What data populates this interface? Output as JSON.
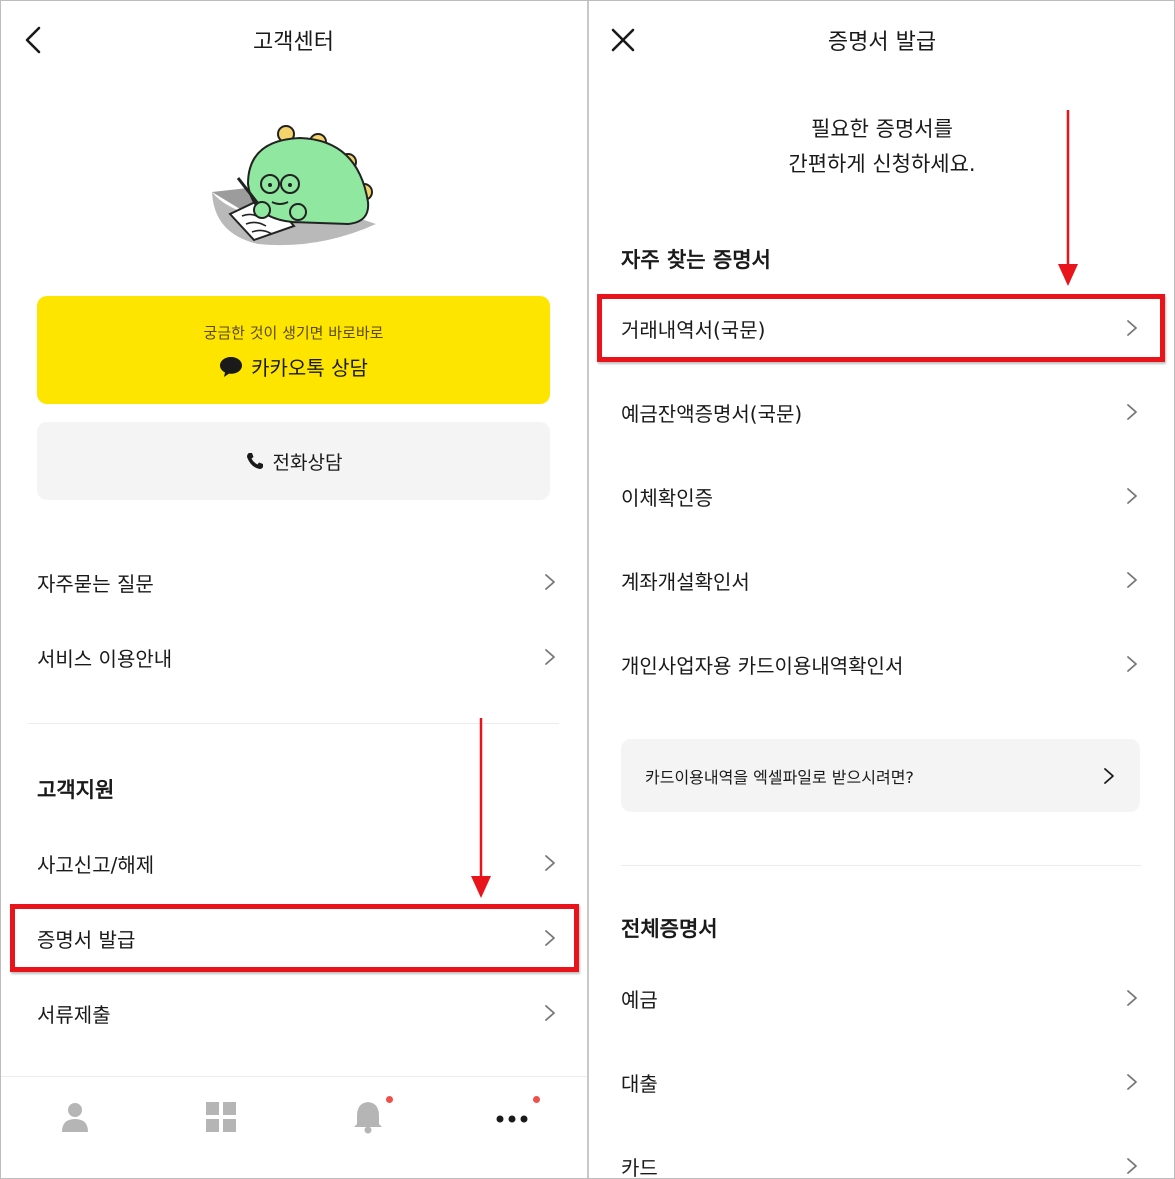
{
  "left": {
    "header": {
      "title": "고객센터",
      "back_icon": "chevron-left-icon"
    },
    "kakao": {
      "subtitle": "궁금한 것이 생기면 바로바로",
      "label": "카카오톡 상담",
      "icon": "speech-bubble-icon",
      "color": "#fee500"
    },
    "phone": {
      "label": "전화상담",
      "icon": "phone-icon"
    },
    "menu": [
      {
        "label": "자주묻는 질문"
      },
      {
        "label": "서비스 이용안내"
      }
    ],
    "support": {
      "title": "고객지원",
      "items": [
        {
          "label": "사고신고/해제"
        },
        {
          "label": "증명서 발급"
        },
        {
          "label": "서류제출"
        }
      ]
    },
    "tabbar": [
      {
        "name": "profile-icon"
      },
      {
        "name": "grid-icon"
      },
      {
        "name": "bell-icon",
        "badge": true
      },
      {
        "name": "more-icon",
        "badge": true
      }
    ]
  },
  "right": {
    "header": {
      "title": "증명서 발급",
      "close_icon": "close-icon"
    },
    "intro": {
      "line1": "필요한 증명서를",
      "line2": "간편하게 신청하세요."
    },
    "frequent": {
      "title": "자주 찾는 증명서",
      "items": [
        {
          "label": "거래내역서(국문)"
        },
        {
          "label": "예금잔액증명서(국문)"
        },
        {
          "label": "이체확인증"
        },
        {
          "label": "계좌개설확인서"
        },
        {
          "label": "개인사업자용 카드이용내역확인서"
        }
      ]
    },
    "excel": {
      "label": "카드이용내역을 엑셀파일로 받으시려면?"
    },
    "all": {
      "title": "전체증명서",
      "items": [
        {
          "label": "예금"
        },
        {
          "label": "대출"
        },
        {
          "label": "카드"
        }
      ]
    }
  },
  "annotation": {
    "highlight_color": "#e8131b"
  }
}
